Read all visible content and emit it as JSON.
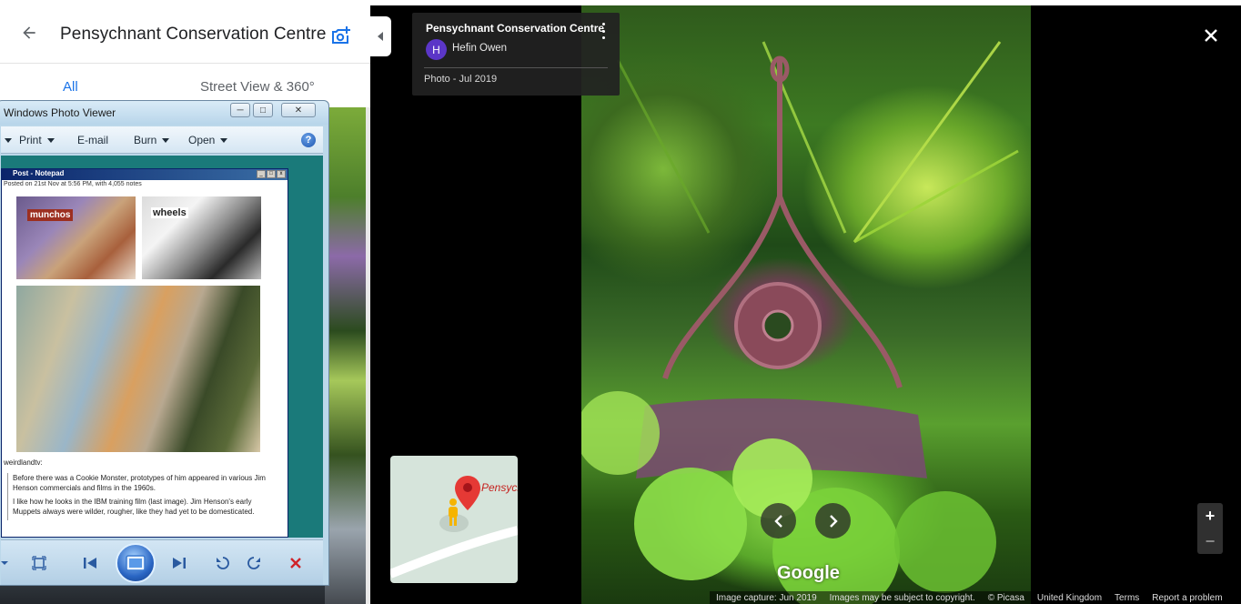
{
  "left_panel": {
    "title": "Pensychnant Conservation Centre",
    "tabs": [
      {
        "label": "All",
        "active": true
      },
      {
        "label": "Street View & 360°",
        "active": false
      }
    ],
    "accent_color": "#1a73e8"
  },
  "photo_viewer": {
    "window_title": "Windows Photo Viewer",
    "toolbar": {
      "print": "Print",
      "email": "E-mail",
      "burn": "Burn",
      "open": "Open",
      "help": "?"
    },
    "embedded": {
      "notepad_title": "Post - Notepad",
      "meta": "Posted on 21st Nov at 5:56 PM, with 4,055 notes",
      "img1_label": "munchos",
      "img2_label": "wheels",
      "user": "weirdlandtv:",
      "quote": [
        "Before there was a Cookie Monster, prototypes of him appeared in various Jim Henson commercials and films in the 1960s.",
        "I like how he looks in the IBM training film (last image). Jim Henson's early Muppets always were wilder, rougher, like they had yet to be domesticated."
      ]
    }
  },
  "viewer": {
    "place_title": "Pensychnant Conservation Centre",
    "author_initial": "H",
    "author": "Hefin Owen",
    "date": "Photo - Jul 2019",
    "avatar_color": "#5b36c7",
    "minimap_label": "Pensychnant Conse",
    "google_logo": "Google",
    "zoom_in": "+",
    "zoom_out": "−",
    "footer": {
      "capture": "Image capture: Jun 2019",
      "copyright": "Images may be subject to copyright.",
      "picasa": "© Picasa",
      "region": "United Kingdom",
      "terms": "Terms",
      "report": "Report a problem"
    }
  }
}
